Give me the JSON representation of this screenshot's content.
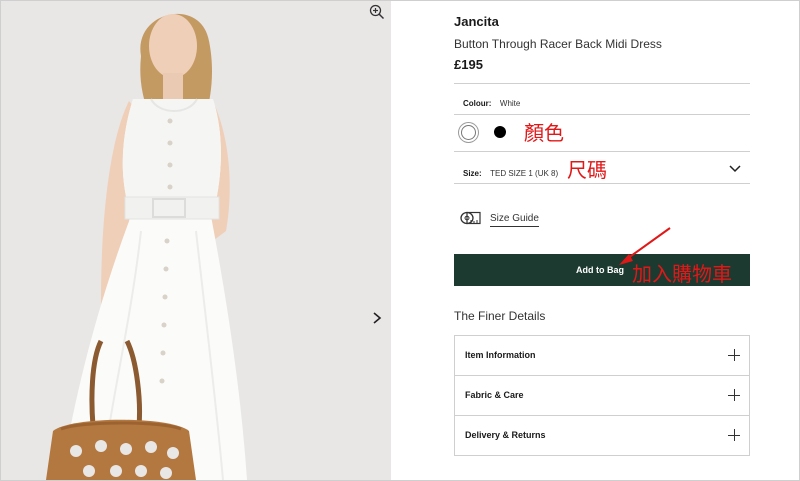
{
  "product": {
    "brand": "Jancita",
    "name": "Button Through Racer Back Midi Dress",
    "price": "£195"
  },
  "colour": {
    "label": "Colour:",
    "value": "White"
  },
  "swatches": [
    {
      "name": "White",
      "color": "#ffffff",
      "selected": true
    },
    {
      "name": "Black",
      "color": "#000000",
      "selected": false
    }
  ],
  "size": {
    "label": "Size:",
    "value": "TED SIZE 1 (UK 8)"
  },
  "size_guide": {
    "label": "Size Guide"
  },
  "add_to_bag": {
    "label": "Add to Bag"
  },
  "annotations": {
    "colour": "顏色",
    "size": "尺碼",
    "add_to_bag": "加入購物車",
    "color": "#e01818"
  },
  "finer_details": {
    "heading": "The Finer Details"
  },
  "accordion": [
    {
      "label": "Item Information"
    },
    {
      "label": "Fabric & Care"
    },
    {
      "label": "Delivery & Returns"
    }
  ],
  "colors": {
    "button_bg": "#1d3a30",
    "border": "#cfcfcf",
    "photo_bg": "#e9e6e6"
  },
  "icons": {
    "zoom": "zoom-in-icon",
    "next": "chevron-right-icon",
    "dropdown": "chevron-down-icon",
    "size_guide": "measuring-tape-icon",
    "expand": "plus-icon"
  }
}
